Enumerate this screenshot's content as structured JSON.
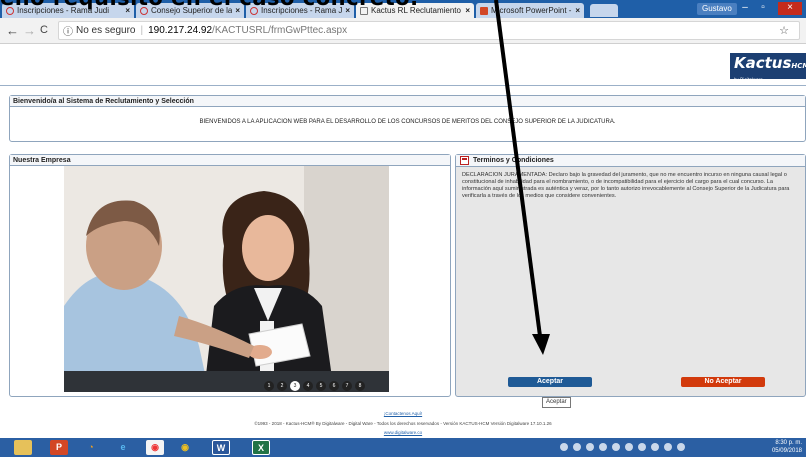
{
  "slide_caption": "ello requisito en el caso concreto.",
  "browser": {
    "tabs": [
      {
        "label": "Inscripciones - Rama Judi",
        "icon": "scale-icon"
      },
      {
        "label": "Consejo Superior de la Jud",
        "icon": "scale-icon"
      },
      {
        "label": "Inscripciones - Rama Judi",
        "icon": "scale-icon"
      },
      {
        "label": "Kactus RL Reclutamiento",
        "icon": "document-icon"
      },
      {
        "label": "Microsoft PowerPoint - ",
        "icon": "powerpoint-icon"
      }
    ],
    "tab_close": "×",
    "user": "Gustavo",
    "url_info": "No es seguro",
    "url_host": "190.217.24.92",
    "url_path": "/KACTUSRL/frmGwPttec.aspx",
    "back": "←",
    "forward": "→",
    "reload": "C",
    "star": "☆",
    "minimize": "–",
    "maximize": "▫",
    "close": "×"
  },
  "logo": {
    "name": "Kactus",
    "suffix": "HCM",
    "tagline": "by Digitalware"
  },
  "welcome": {
    "title": "Bienvenido/a al Sistema de Reclutamiento y Selección",
    "body": "BIENVENIDOS A LA APLICACION WEB PARA EL DESARROLLO DE LOS CONCURSOS DE MERITOS DEL CONSEJO SUPERIOR DE LA JUDICATURA."
  },
  "company": {
    "title": "Nuestra Empresa",
    "slides": [
      "1",
      "2",
      "3",
      "4",
      "5",
      "6",
      "7",
      "8"
    ],
    "current_slide": 3
  },
  "terms": {
    "title": "Terminos y Condiciones",
    "text": "DECLARACION JURAMENTADA: Declaro bajo la gravedad del juramento, que no me encuentro incurso en ninguna causal legal o constitucional de inhabilidad para el nombramiento, o de incompatibilidad para el ejercicio del cargo para el cual concurso. La información aquí suministrada es auténtica y veraz, por lo tanto autorizo irrevocablemente al Consejo Superior de la Judicatura para verificarla a través de los medios que considere convenientes.",
    "accept": "Aceptar",
    "decline": "No Aceptar",
    "tooltip": "Aceptar"
  },
  "footer": {
    "contact": "¡Contactenos Aquí!",
    "copyright": "©1993 - 2018 - Kactus-HCM® By Digitalware - Digital Ware - Todos los derechos reservados - Versión KACTUS-HCM Versión Digitalware 17.10.1.26",
    "site": "www.digitalware.co"
  },
  "taskbar": {
    "apps": [
      "explorer-icon",
      "powerpoint-icon",
      "firefox-icon",
      "ie-icon",
      "chrome-icon",
      "chrome-canary-icon",
      "word-icon",
      "excel-icon"
    ],
    "time": "8:30 p. m.",
    "date": "05/09/2018"
  },
  "colors": {
    "accent": "#1f5a96",
    "decline": "#d23a0c",
    "chrome_blue": "#1f5fa8"
  }
}
